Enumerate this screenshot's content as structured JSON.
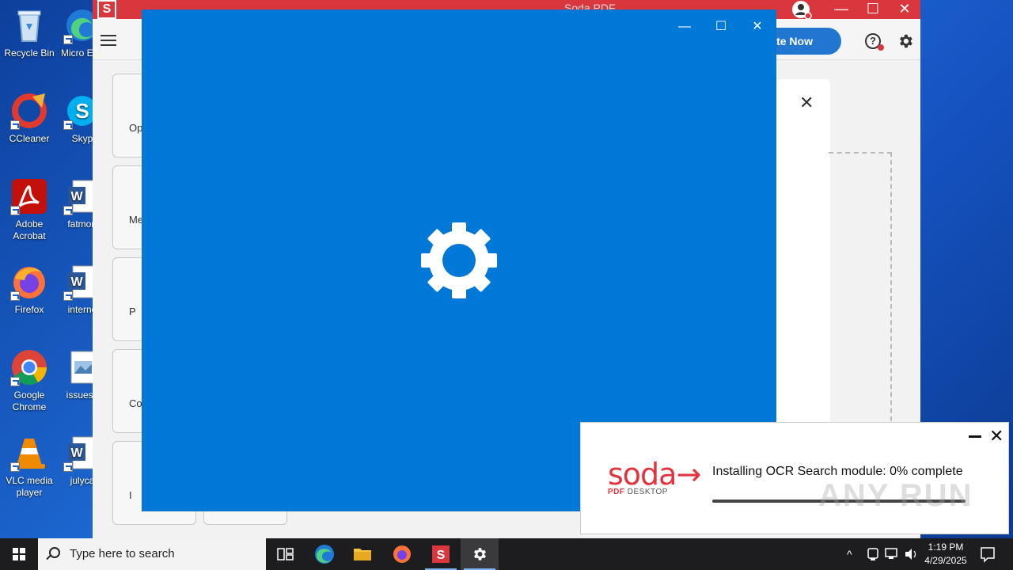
{
  "desktop": {
    "icons_col1": [
      {
        "name": "recycle-bin",
        "label": "Recycle Bin"
      },
      {
        "name": "ccleaner",
        "label": "CCleaner"
      },
      {
        "name": "adobe-acrobat",
        "label": "Adobe Acrobat"
      },
      {
        "name": "firefox",
        "label": "Firefox"
      },
      {
        "name": "google-chrome",
        "label": "Google Chrome"
      },
      {
        "name": "vlc-media-player",
        "label": "VLC media player"
      }
    ],
    "icons_col2": [
      {
        "name": "microsoft-edge",
        "label": "Micro Edg"
      },
      {
        "name": "skype",
        "label": "Skyp"
      },
      {
        "name": "fatmort",
        "label": "fatmort"
      },
      {
        "name": "interne",
        "label": "interne"
      },
      {
        "name": "issuesh",
        "label": "issuesh"
      },
      {
        "name": "julyca",
        "label": "julyca"
      }
    ]
  },
  "soda_window": {
    "title": "Soda PDF",
    "logo_letter": "S",
    "activate_label": "ate Now",
    "help_glyph": "?",
    "left_cards": [
      "Op",
      "Me t",
      "P",
      "Co",
      "I"
    ]
  },
  "settings_window": {
    "controls": {
      "minimize": "—",
      "maximize": "☐",
      "close": "✕"
    }
  },
  "toast": {
    "brand_name": "soda",
    "brand_arrow": "→",
    "brand_sub_pdf": "PDF",
    "brand_sub_desktop": "DESKTOP",
    "message": "Installing OCR Search module: 0% complete",
    "progress_percent": 0,
    "minimize_glyph": "—",
    "close_glyph": "✕"
  },
  "watermark": "ANY RUN",
  "taskbar": {
    "search_placeholder": "Type here to search",
    "apps": [
      "task-view",
      "microsoft-edge",
      "file-explorer",
      "firefox",
      "soda-pdf",
      "settings"
    ],
    "tray_chevron": "^",
    "time": "1:19 PM",
    "date": "4/29/2025"
  },
  "colors": {
    "soda_red": "#d9363e",
    "settings_blue": "#0078d7",
    "activate_blue": "#2176d2",
    "taskbar": "#1d1d1f"
  }
}
